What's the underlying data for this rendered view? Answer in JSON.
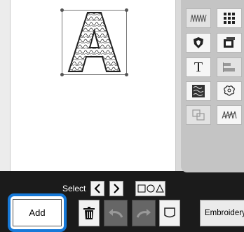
{
  "canvas": {
    "design_letter": "A"
  },
  "palette": {
    "tools": [
      {
        "name": "stitch-pattern-icon"
      },
      {
        "name": "grid-pattern-icon"
      },
      {
        "name": "shield-emblem-icon"
      },
      {
        "name": "frame-pattern-icon"
      },
      {
        "name": "text-icon",
        "label": "T"
      },
      {
        "name": "align-icon"
      },
      {
        "name": "texture-pattern-icon"
      },
      {
        "name": "flower-icon"
      },
      {
        "name": "layers-icon"
      },
      {
        "name": "hand-stitch-icon"
      }
    ]
  },
  "toolbar": {
    "select_label": "Select",
    "add_label": "Add",
    "embroidery_label": "Embroidery"
  },
  "colors": {
    "accent": "#1679d8",
    "background": "#1b1b1b",
    "palette": "#c4c4c4"
  }
}
